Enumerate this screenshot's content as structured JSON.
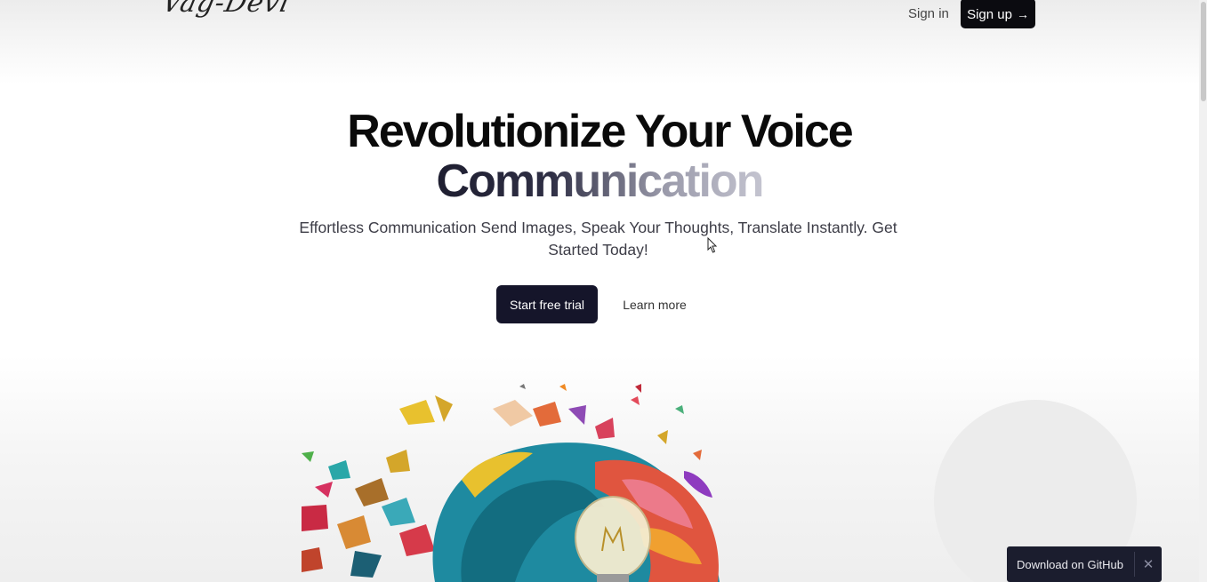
{
  "header": {
    "logo_text": "Vag-Devi",
    "sign_in_label": "Sign in",
    "sign_up_label": "Sign up",
    "sign_up_icon": "arrow-right-icon"
  },
  "hero": {
    "headline_line1": "Revolutionize Your Voice",
    "headline_line2": "Communication",
    "subtitle": "Effortless Communication Send Images, Speak Your Thoughts, Translate Instantly. Get Started Today!",
    "primary_cta": "Start free trial",
    "secondary_cta": "Learn more",
    "illustration": "colorful-exploding-head-with-lightbulb"
  },
  "toast": {
    "label": "Download on GitHub",
    "close_icon": "close-icon"
  },
  "colors": {
    "brand_dark": "#15152a",
    "button_black": "#0b0b10",
    "toast_bg": "#1b1d2e",
    "subtitle_text": "#3d3d47"
  }
}
